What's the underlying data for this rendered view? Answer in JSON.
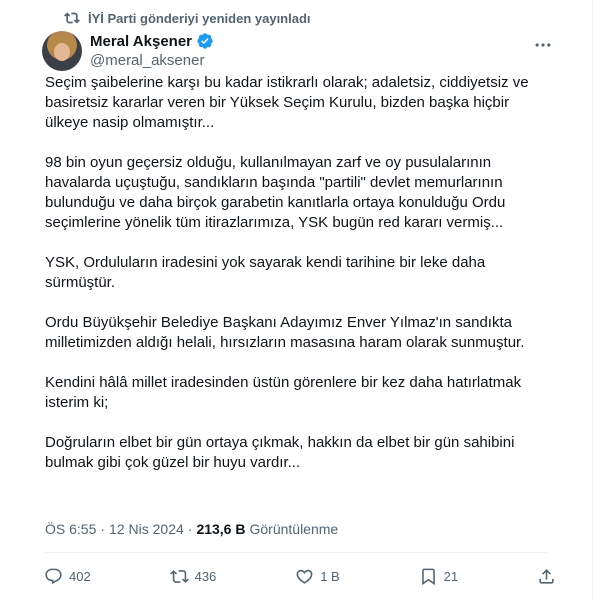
{
  "repost": {
    "text": "İYİ Parti gönderiyi yeniden yayınladı",
    "icon": "repost-icon"
  },
  "author": {
    "name": "Meral Akşener",
    "handle": "@meral_aksener",
    "verified_icon": "verified-badge-icon"
  },
  "tweet": {
    "paragraphs": [
      "Seçim şaibelerine karşı bu kadar istikrarlı olarak; adaletsiz, ciddiyetsiz ve basiretsiz kararlar veren bir Yüksek Seçim Kurulu, bizden başka hiçbir ülkeye nasip olmamıştır...",
      "98 bin oyun geçersiz olduğu, kullanılmayan zarf ve oy pusulalarının havalarda uçuştuğu, sandıkların başında \"partili\" devlet memurlarının bulunduğu ve daha birçok garabetin kanıtlarla ortaya konulduğu Ordu seçimlerine yönelik tüm itirazlarımıza, YSK bugün red kararı vermiş...",
      "YSK, Orduluların iradesini yok sayarak kendi tarihine bir leke daha sürmüştür.",
      "Ordu Büyükşehir Belediye Başkanı Adayımız Enver Yılmaz'ın sandıkta milletimizden aldığı helali, hırsızların masasına haram olarak sunmuştur.",
      "Kendini hâlâ millet iradesinden üstün görenlere bir kez daha hatırlatmak isterim ki;",
      "Doğruların elbet bir gün ortaya çıkmak, hakkın da elbet bir gün sahibini bulmak gibi çok güzel bir huyu vardır..."
    ]
  },
  "meta": {
    "time": "ÖS 6:55",
    "separator": "·",
    "date": "12 Nis 2024",
    "views_count": "213,6 B",
    "views_label": "Görüntülenme"
  },
  "actions": {
    "replies": "402",
    "reposts": "436",
    "likes": "1 B",
    "bookmarks": "21"
  },
  "colors": {
    "text": "#0f1419",
    "secondary": "#536471",
    "verified": "#1d9bf0",
    "divider": "#eff3f4"
  }
}
